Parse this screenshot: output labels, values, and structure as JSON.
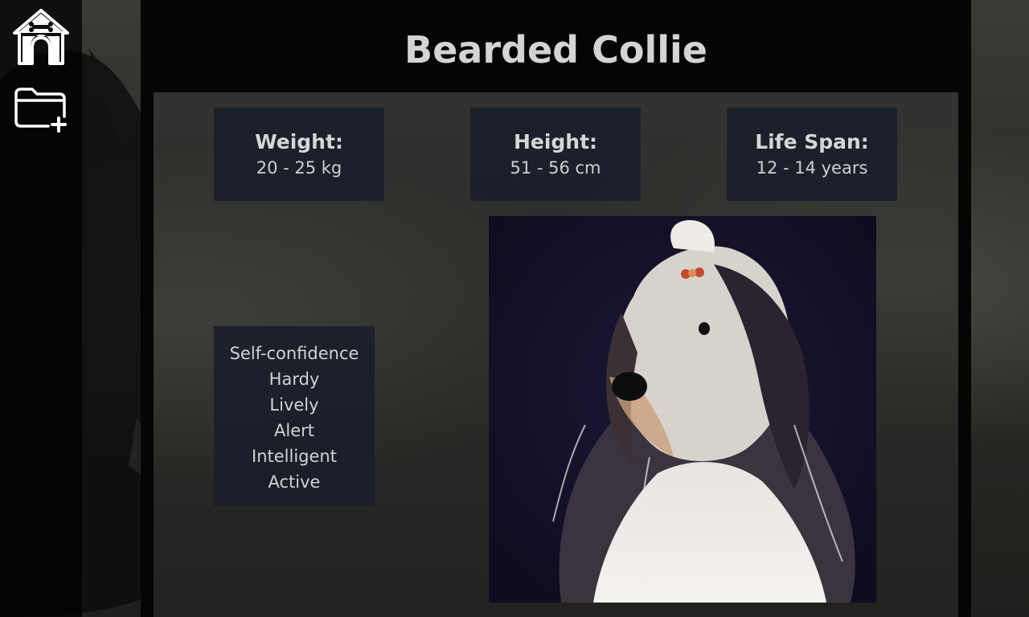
{
  "nav": {
    "home_icon": "dog-house-icon",
    "add_icon": "folder-add-icon"
  },
  "breed": {
    "name": "Bearded Collie"
  },
  "stats": [
    {
      "label": "Weight:",
      "value": "20 - 25 kg"
    },
    {
      "label": "Height:",
      "value": "51 - 56 cm"
    },
    {
      "label": "Life Span:",
      "value": "12 - 14 years"
    }
  ],
  "temperament": [
    "Self-confidence",
    "Hardy",
    "Lively",
    "Alert",
    "Intelligent",
    "Active"
  ],
  "colors": {
    "panel": "#050505",
    "card": "#1d2230",
    "text": "#d4d4d4"
  }
}
